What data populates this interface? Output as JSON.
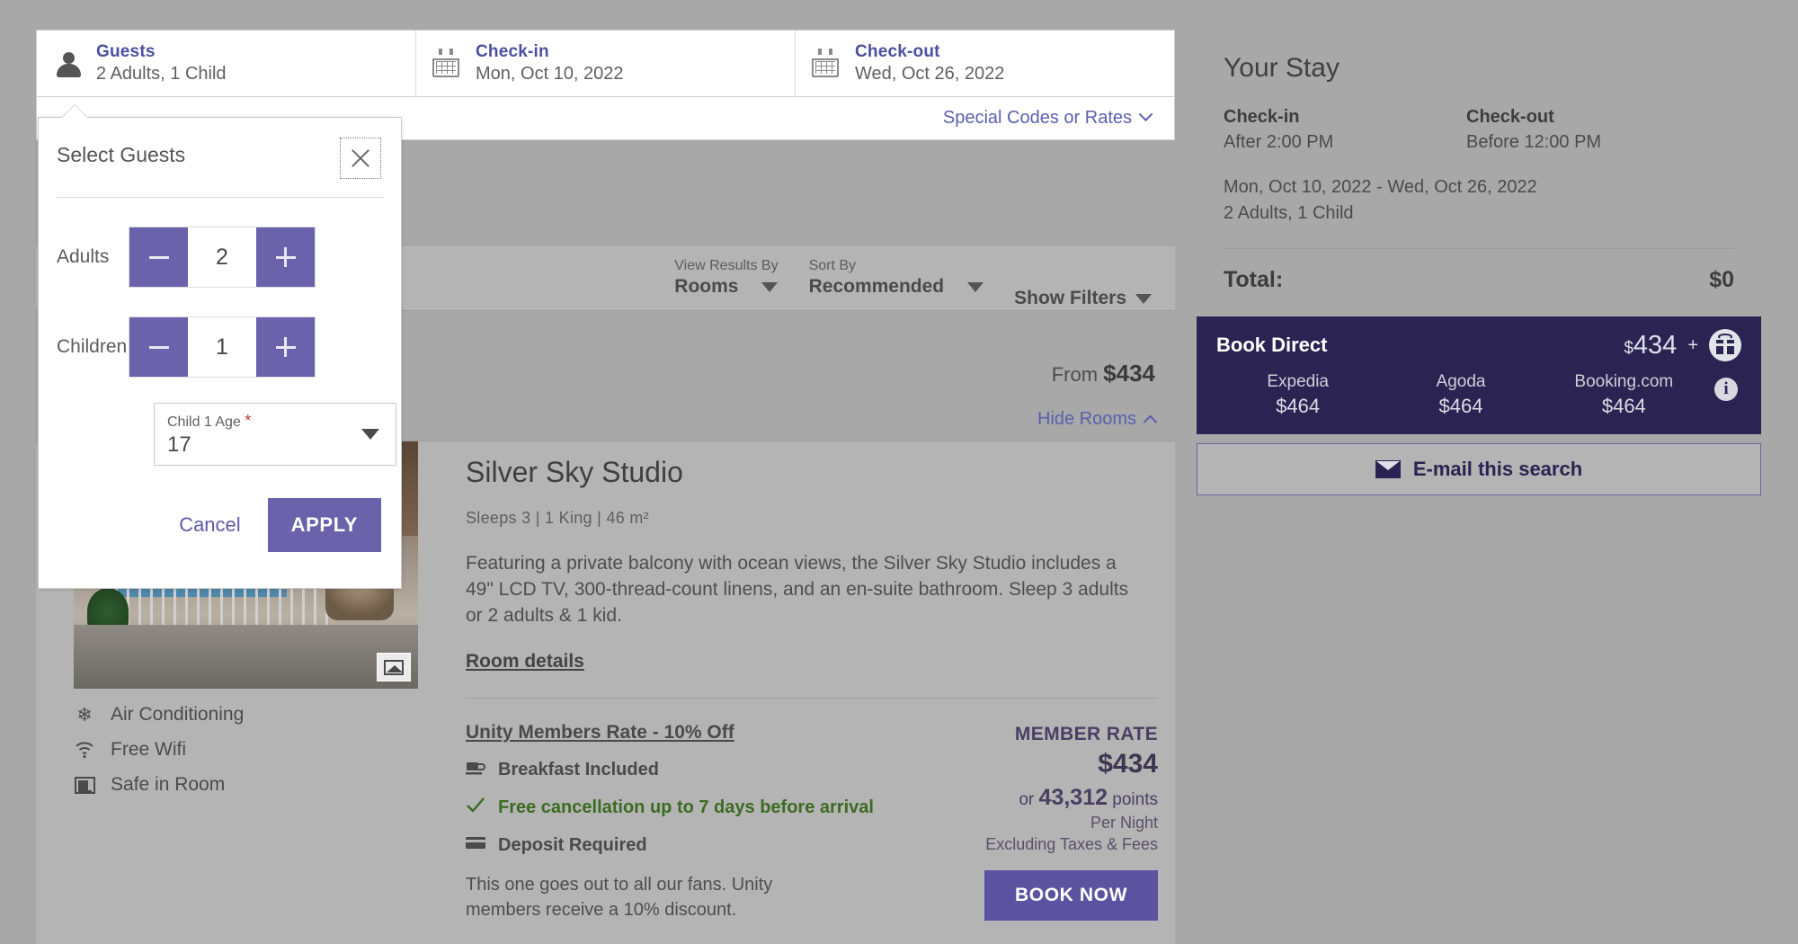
{
  "searchbar": {
    "guests": {
      "label": "Guests",
      "value": "2 Adults, 1 Child",
      "icon": "person-icon"
    },
    "checkin": {
      "label": "Check-in",
      "value": "Mon, Oct 10, 2022",
      "icon": "calendar-icon"
    },
    "checkout": {
      "label": "Check-out",
      "value": "Wed, Oct 26, 2022",
      "icon": "calendar-icon"
    },
    "special_codes": "Special Codes or Rates"
  },
  "filterbar": {
    "view_results_by_caption": "View Results By",
    "view_results_by_value": "Rooms",
    "sort_by_caption": "Sort By",
    "sort_by_value": "Recommended",
    "show_filters": "Show Filters"
  },
  "listing": {
    "from_prefix": "From ",
    "from_price": "$434",
    "hide_rooms": "Hide Rooms"
  },
  "room": {
    "title": "Silver Sky Studio",
    "meta": "Sleeps 3   |   1 King   |   46 m²",
    "description": "Featuring a private balcony with ocean views, the Silver Sky Studio includes a 49\" LCD TV, 300-thread-count linens, and an en-suite bathroom. Sleep 3 adults or 2 adults & 1 kid.",
    "details_link": "Room details",
    "amenities": [
      {
        "icon": "air-conditioning-icon",
        "glyph": "❄",
        "label": "Air Conditioning"
      },
      {
        "icon": "wifi-icon",
        "glyph": "ᴘ",
        "label": "Free Wifi"
      },
      {
        "icon": "safe-icon",
        "glyph": "▤",
        "label": "Safe in Room"
      }
    ],
    "photo_badge_icon": "photo-gallery-icon"
  },
  "rate": {
    "name": "Unity Members Rate - 10% Off",
    "features": [
      {
        "icon": "coffee-cup-icon",
        "glyph": "☕",
        "label": "Breakfast Included",
        "green": false
      },
      {
        "icon": "check-icon",
        "glyph": "✓",
        "label": "Free cancellation up to 7 days before arrival",
        "green": true
      },
      {
        "icon": "credit-card-icon",
        "glyph": "▬",
        "label": "Deposit Required",
        "green": false
      }
    ],
    "note": "This one goes out to all our fans. Unity members receive a 10% discount.",
    "member_rate_label": "MEMBER RATE",
    "price": "$434",
    "points_prefix": "or ",
    "points_value": "43,312",
    "points_suffix": " points",
    "per_night": "Per Night",
    "excluding": "Excluding Taxes & Fees",
    "book_now": "BOOK NOW"
  },
  "your_stay": {
    "title": "Your Stay",
    "checkin_label": "Check-in",
    "checkin_time": "After 2:00 PM",
    "checkout_label": "Check-out",
    "checkout_time": "Before 12:00 PM",
    "date_range": "Mon, Oct 10, 2022 - Wed, Oct 26, 2022",
    "guests": "2 Adults, 1 Child",
    "total_label": "Total:",
    "total_value": "$0"
  },
  "book_direct": {
    "label": "Book Direct",
    "currency": "$",
    "price": "434",
    "plus": "+",
    "gift_icon": "gift-icon",
    "info_icon": "info-icon",
    "info_glyph": "i",
    "otas": [
      {
        "name": "Expedia",
        "price": "$464"
      },
      {
        "name": "Agoda",
        "price": "$464"
      },
      {
        "name": "Booking.com",
        "price": "$464"
      }
    ],
    "email_button": "E-mail this search",
    "email_icon": "envelope-icon"
  },
  "guests_modal": {
    "title": "Select Guests",
    "close_icon": "close-icon",
    "adults": {
      "label": "Adults",
      "value": "2",
      "minus": "−",
      "plus": "+"
    },
    "children": {
      "label": "Children",
      "value": "1",
      "minus": "−",
      "plus": "+"
    },
    "child_age": {
      "label": "Child 1 Age",
      "required_mark": "*",
      "value": "17"
    },
    "cancel": "Cancel",
    "apply": "APPLY"
  },
  "colors": {
    "accent_purple": "#6a63ab",
    "link_purple": "#5b5fb0",
    "dark_navy": "#2b2352",
    "green": "#3c6b22",
    "page_bg": "#a8a8a8"
  }
}
